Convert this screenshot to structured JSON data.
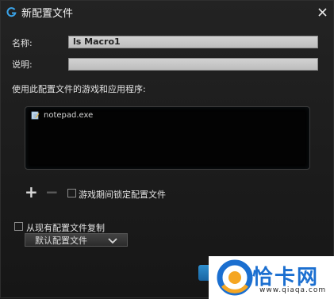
{
  "window": {
    "title": "新配置文件"
  },
  "form": {
    "name_label": "名称:",
    "name_value": "ls Macro1",
    "desc_label": "说明:",
    "desc_value": ""
  },
  "apps": {
    "label": "使用此配置文件的游戏和应用程序:",
    "items": [
      {
        "name": "notepad.exe"
      }
    ]
  },
  "controls": {
    "add_symbol": "+",
    "remove_symbol": "−",
    "lock_label": "游戏期间锁定配置文件",
    "lock_checked": false,
    "copy_label": "从现有配置文件复制",
    "copy_checked": false,
    "copy_select_value": "默认配置文件"
  },
  "watermark": {
    "text": "恰卡网",
    "url": "www.qiaqa.com"
  },
  "colors": {
    "accent": "#1b6fd0",
    "button": "#2f8fce"
  }
}
